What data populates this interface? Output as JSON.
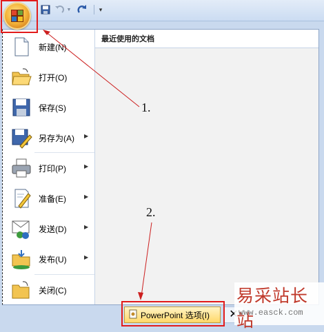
{
  "menu": {
    "recent_title": "最近使用的文档",
    "items": [
      {
        "label": "新建(N)",
        "icon": "new-document-icon",
        "has_submenu": false
      },
      {
        "label": "打开(O)",
        "icon": "open-folder-icon",
        "has_submenu": false
      },
      {
        "label": "保存(S)",
        "icon": "save-floppy-icon",
        "has_submenu": false
      },
      {
        "label": "另存为(A)",
        "icon": "save-as-icon",
        "has_submenu": true
      },
      {
        "label": "打印(P)",
        "icon": "printer-icon",
        "has_submenu": true
      },
      {
        "label": "准备(E)",
        "icon": "prepare-icon",
        "has_submenu": true
      },
      {
        "label": "发送(D)",
        "icon": "send-icon",
        "has_submenu": true
      },
      {
        "label": "发布(U)",
        "icon": "publish-icon",
        "has_submenu": true
      },
      {
        "label": "关闭(C)",
        "icon": "close-folder-icon",
        "has_submenu": false
      }
    ],
    "options_button": "PowerPoint 选项(I)",
    "exit_button_glyph": "✕"
  },
  "quick_access": {
    "icons": [
      "save-icon",
      "undo-icon",
      "redo-icon",
      "customize-icon"
    ]
  },
  "annotations": {
    "step1": "1.",
    "step2": "2."
  },
  "watermark": {
    "text": "易采站长站",
    "url": "www.easck.com"
  },
  "colors": {
    "highlight_box": "#e21b1b",
    "options_button_bg": "#ffd869",
    "office_button": "#f4b53a"
  }
}
